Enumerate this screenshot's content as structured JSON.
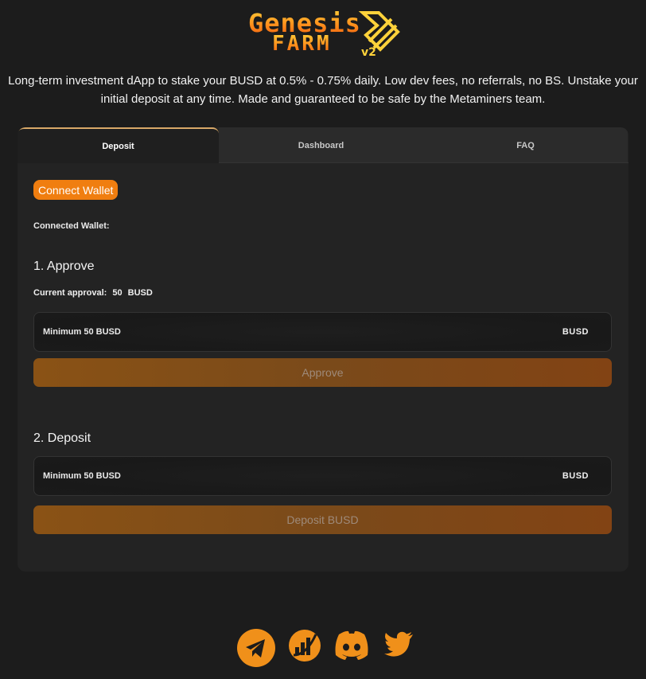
{
  "logo": {
    "line1": "Genesis",
    "line2": "FARM",
    "badge": "v2"
  },
  "tagline": "Long-term investment dApp to stake your BUSD at 0.5% - 0.75% daily. Low dev fees, no referrals, no BS. Unstake your initial deposit at any time. Made and guaranteed to be safe by the Metaminers team.",
  "tabs": [
    {
      "label": "Deposit",
      "active": true
    },
    {
      "label": "Dashboard",
      "active": false
    },
    {
      "label": "FAQ",
      "active": false
    }
  ],
  "wallet": {
    "connect_label": "Connect Wallet",
    "connected_label": "Connected Wallet:"
  },
  "approve": {
    "title": "1. Approve",
    "current_label": "Current approval:",
    "current_value": "50",
    "current_unit": "BUSD",
    "input_placeholder": "Minimum 50 BUSD",
    "input_unit": "BUSD",
    "button_label": "Approve"
  },
  "deposit": {
    "title": "2. Deposit",
    "input_placeholder": "Minimum 50 BUSD",
    "input_unit": "BUSD",
    "button_label": "Deposit BUSD"
  },
  "socials": [
    "telegram-icon",
    "chart-icon",
    "discord-icon",
    "twitter-icon"
  ],
  "colors": {
    "accent": "#f07e10",
    "background": "#1c1c1c",
    "card": "#232323",
    "icon": "#f0901a"
  }
}
